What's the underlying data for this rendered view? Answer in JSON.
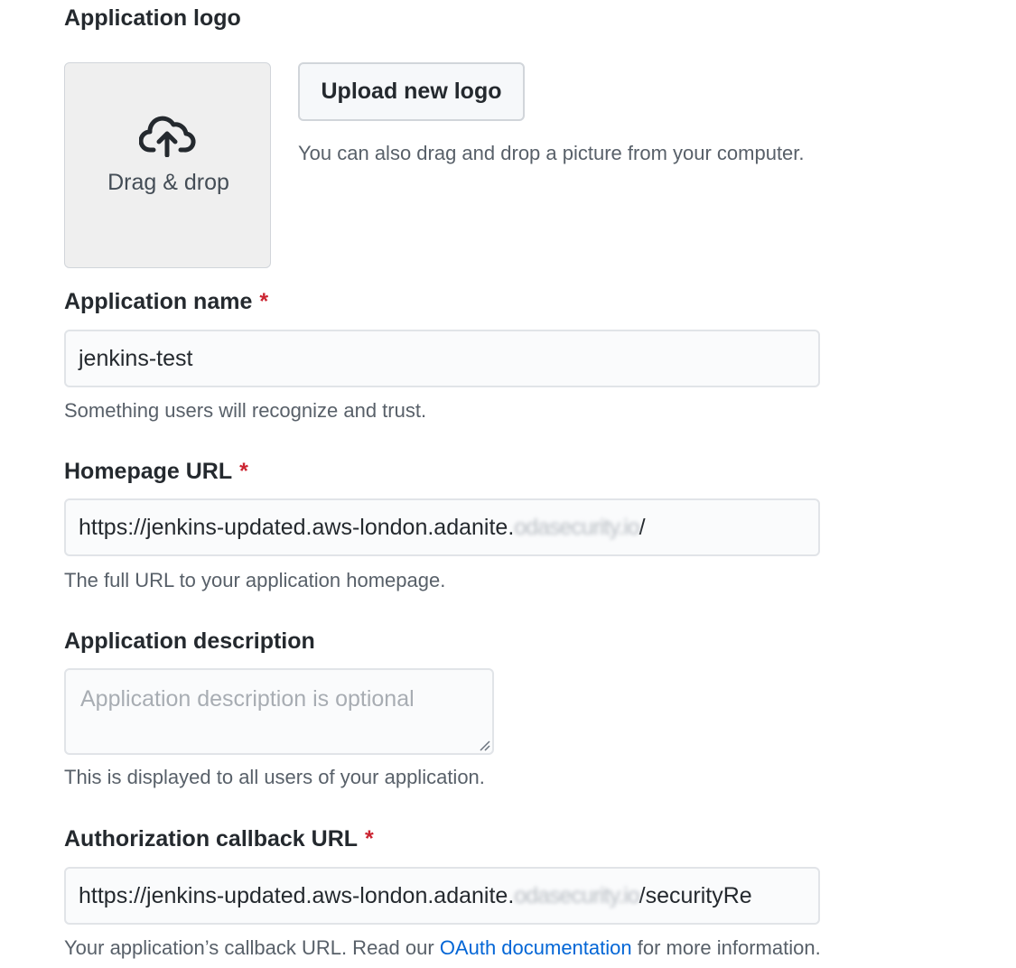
{
  "logo": {
    "label": "Application logo",
    "dropzone_text": "Drag & drop",
    "upload_button": "Upload new logo",
    "hint": "You can also drag and drop a picture from your computer.",
    "icon": "cloud-upload-icon"
  },
  "name": {
    "label": "Application name",
    "required_mark": "*",
    "value": "jenkins-test",
    "hint": "Something users will recognize and trust."
  },
  "homepage": {
    "label": "Homepage URL",
    "required_mark": "*",
    "value_prefix": "https://jenkins-updated.aws-london.adanite.",
    "value_blurred": "odasecurity.io",
    "value_suffix": "/",
    "hint": "The full URL to your application homepage."
  },
  "description": {
    "label": "Application description",
    "placeholder": "Application description is optional",
    "hint": "This is displayed to all users of your application."
  },
  "callback": {
    "label": "Authorization callback URL",
    "required_mark": "*",
    "value_prefix": "https://jenkins-updated.aws-london.adanite.",
    "value_blurred": "odasecurity.io",
    "value_suffix": "/securityRe",
    "hint_before": "Your application’s callback URL. Read our ",
    "hint_link": "OAuth documentation",
    "hint_after": " for more information."
  },
  "colors": {
    "required": "#cb2431",
    "link": "#0366d6",
    "muted_text": "#586069"
  }
}
